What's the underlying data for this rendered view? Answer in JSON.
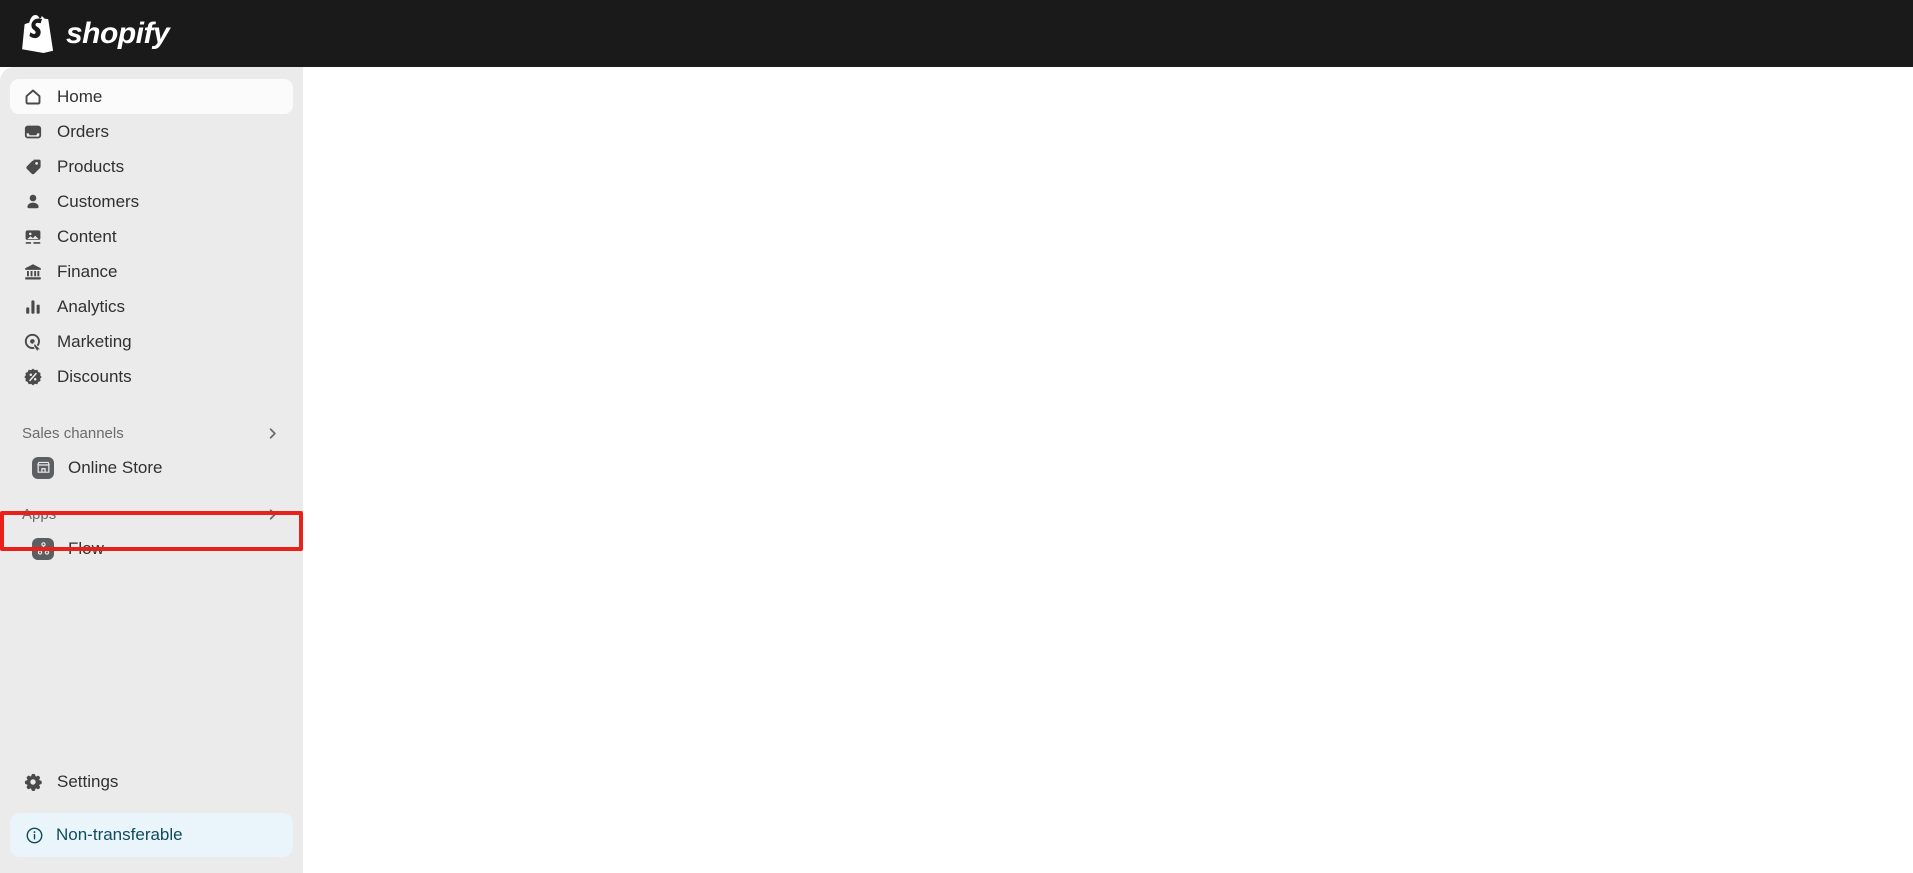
{
  "topbar": {
    "brand_name": "shopify",
    "logo_icon": "shopify-bag-icon",
    "background_color": "#1a1a1a"
  },
  "sidebar": {
    "background_color": "#ebebeb",
    "primary_items": [
      {
        "label": "Home",
        "icon": "home-icon",
        "active": true
      },
      {
        "label": "Orders",
        "icon": "orders-icon",
        "active": false
      },
      {
        "label": "Products",
        "icon": "products-tag-icon",
        "active": false
      },
      {
        "label": "Customers",
        "icon": "customers-person-icon",
        "active": false
      },
      {
        "label": "Content",
        "icon": "content-image-icon",
        "active": false
      },
      {
        "label": "Finance",
        "icon": "finance-bank-icon",
        "active": false
      },
      {
        "label": "Analytics",
        "icon": "analytics-bar-chart-icon",
        "active": false
      },
      {
        "label": "Marketing",
        "icon": "marketing-target-icon",
        "active": false
      },
      {
        "label": "Discounts",
        "icon": "discounts-percent-icon",
        "active": false
      }
    ],
    "sales_channels": {
      "label": "Sales channels",
      "chevron_icon": "chevron-right-icon",
      "items": [
        {
          "label": "Online Store",
          "icon": "online-store-icon"
        }
      ]
    },
    "apps": {
      "label": "Apps",
      "chevron_icon": "chevron-right-icon",
      "highlighted": true,
      "highlight_color": "#e8211b",
      "items": [
        {
          "label": "Flow",
          "icon": "flow-app-icon"
        }
      ]
    },
    "settings": {
      "label": "Settings",
      "icon": "settings-gear-icon"
    },
    "status_badge": {
      "label": "Non-transferable",
      "icon": "info-circle-icon",
      "background_color": "#eaf4fb",
      "text_color": "#0f4c5c"
    }
  },
  "main": {
    "background_color": "#ffffff",
    "content": ""
  }
}
